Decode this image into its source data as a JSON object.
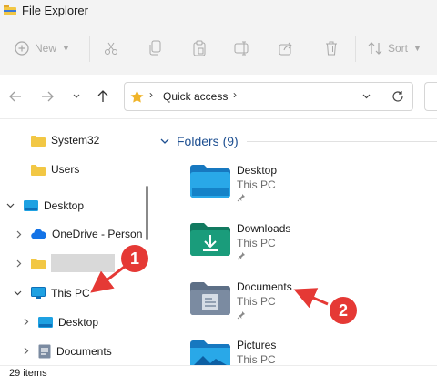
{
  "window": {
    "title": "File Explorer"
  },
  "toolbar": {
    "new_label": "New",
    "sort_label": "Sort",
    "icons": [
      "plus-circle-icon",
      "cut-icon",
      "copy-icon",
      "paste-icon",
      "rename-icon",
      "share-icon",
      "delete-icon",
      "sort-icon"
    ]
  },
  "address": {
    "location": "Quick access"
  },
  "nav_pane": {
    "items": [
      {
        "label": "System32"
      },
      {
        "label": "Users"
      },
      {
        "label": "Desktop"
      },
      {
        "label": "OneDrive - Person"
      },
      {
        "label": ""
      },
      {
        "label": "This PC"
      },
      {
        "label": "Desktop"
      },
      {
        "label": "Documents"
      }
    ]
  },
  "content": {
    "group_title": "Folders (9)",
    "folders": [
      {
        "name": "Desktop",
        "location": "This PC"
      },
      {
        "name": "Downloads",
        "location": "This PC"
      },
      {
        "name": "Documents",
        "location": "This PC"
      },
      {
        "name": "Pictures",
        "location": "This PC"
      }
    ]
  },
  "status": {
    "item_count": "29 items"
  },
  "annotations": {
    "badge_1": "1",
    "badge_2": "2",
    "color": "#e53935"
  },
  "colors": {
    "folder_yellow": "#f2c744",
    "accent_blue": "#1d4f91",
    "downloads_green": "#1a9c7b"
  }
}
